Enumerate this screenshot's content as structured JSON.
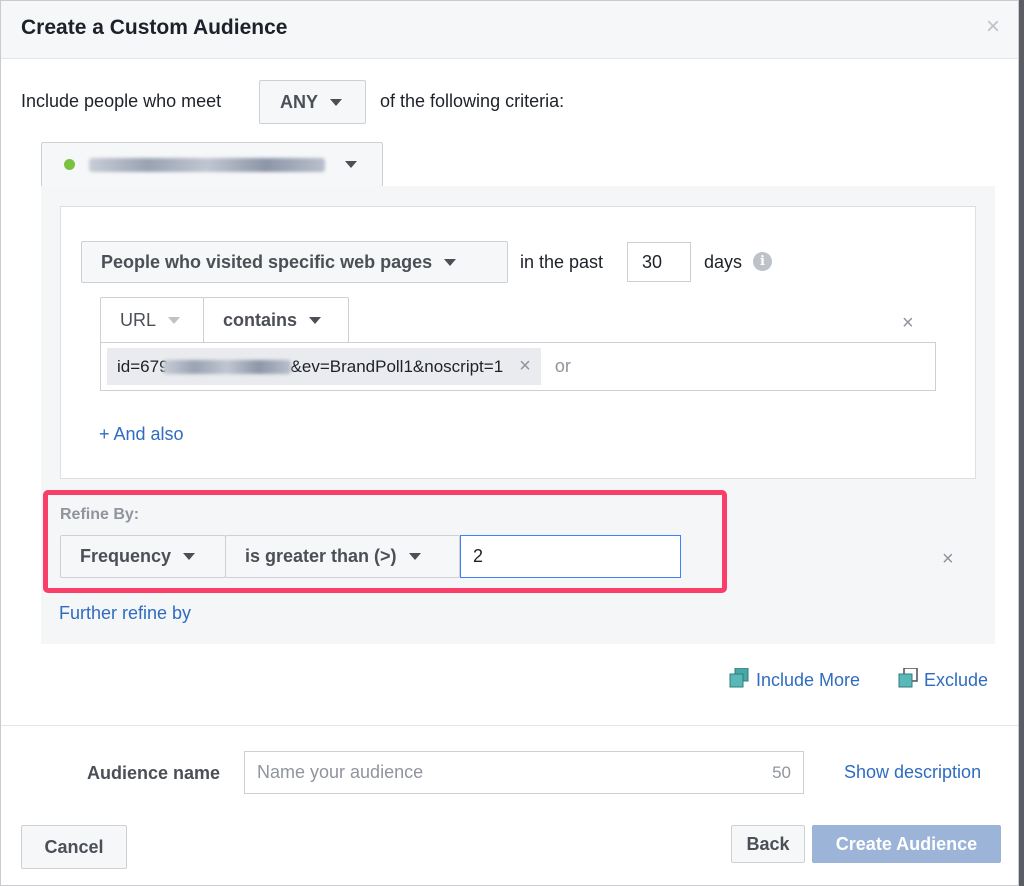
{
  "dialog": {
    "title": "Create a Custom Audience"
  },
  "criteria": {
    "prefix": "Include people who meet",
    "match_value": "ANY",
    "suffix": "of the following criteria:"
  },
  "pixel": {
    "status_color": "#7ac142"
  },
  "rule": {
    "event_type": "People who visited specific web pages",
    "in_the_past_label": "in the past",
    "days_value": "30",
    "days_label": "days",
    "info_icon_glyph": "i",
    "url_field": "URL",
    "operator": "contains",
    "url_token_prefix": "id=679",
    "url_token_suffix": "&ev=BrandPoll1&noscript=1",
    "or_label": "or",
    "and_also": "+ And also"
  },
  "refine": {
    "label": "Refine By:",
    "dimension": "Frequency",
    "operator": "is greater than (>)",
    "value": "2",
    "further_refine": "Further refine by"
  },
  "actions": {
    "include_more": "Include More",
    "exclude": "Exclude"
  },
  "audience_name": {
    "label": "Audience name",
    "placeholder": "Name your audience",
    "char_limit": "50",
    "show_description": "Show description"
  },
  "footer": {
    "cancel": "Cancel",
    "back": "Back",
    "create": "Create Audience"
  },
  "glyphs": {
    "close": "×"
  },
  "colors": {
    "link": "#2f6cc0",
    "highlight": "#fa3e6a",
    "primary_disabled": "#9cb4d8"
  }
}
